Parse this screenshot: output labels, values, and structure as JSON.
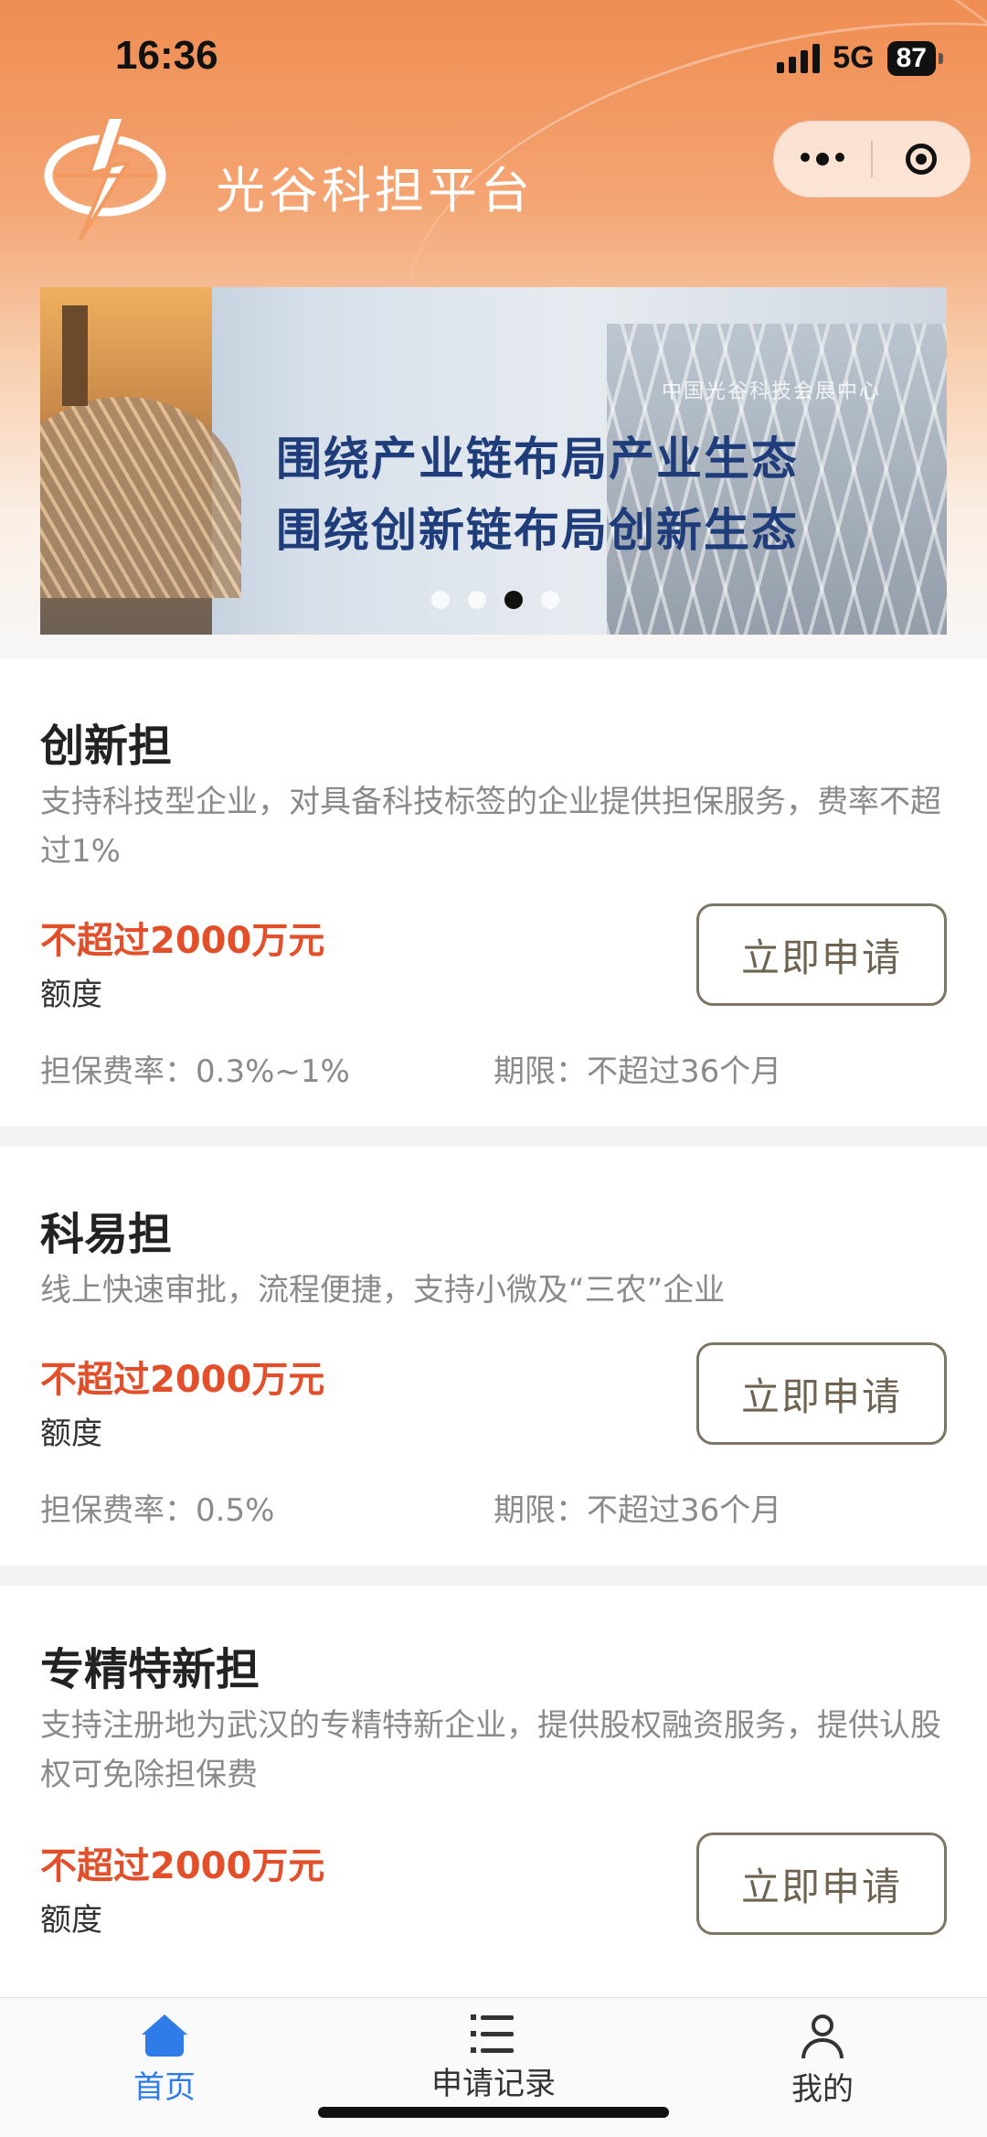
{
  "status_bar": {
    "time": "16:36",
    "network": "5G",
    "battery": "87"
  },
  "header": {
    "title": "光谷科担平台"
  },
  "banner": {
    "line1": "围绕产业链布局产业生态",
    "line2": "围绕创新链布局创新生态",
    "sign": "中国光谷科技会展中心",
    "slide_count": 4,
    "active_slide": 3
  },
  "products": [
    {
      "name": "创新担",
      "description": "支持科技型企业，对具备科技标签的企业提供担保服务，费率不超过1%",
      "amount": "不超过2000万元",
      "amount_label": "额度",
      "fee": "担保费率：0.3%~1%",
      "term": "期限：不超过36个月",
      "button": "立即申请"
    },
    {
      "name": "科易担",
      "description": "线上快速审批，流程便捷，支持小微及“三农”企业",
      "amount": "不超过2000万元",
      "amount_label": "额度",
      "fee": "担保费率：0.5%",
      "term": "期限：不超过36个月",
      "button": "立即申请"
    },
    {
      "name": "专精特新担",
      "description": "支持注册地为武汉的专精特新企业，提供股权融资服务，提供认股权可免除担保费",
      "amount": "不超过2000万元",
      "amount_label": "额度",
      "button": "立即申请"
    }
  ],
  "tabbar": {
    "home": "首页",
    "records": "申请记录",
    "mine": "我的",
    "active": "home",
    "active_color": "#2f7be8"
  },
  "colors": {
    "accent_orange": "#ef8d52",
    "amount_red": "#e2502b"
  }
}
